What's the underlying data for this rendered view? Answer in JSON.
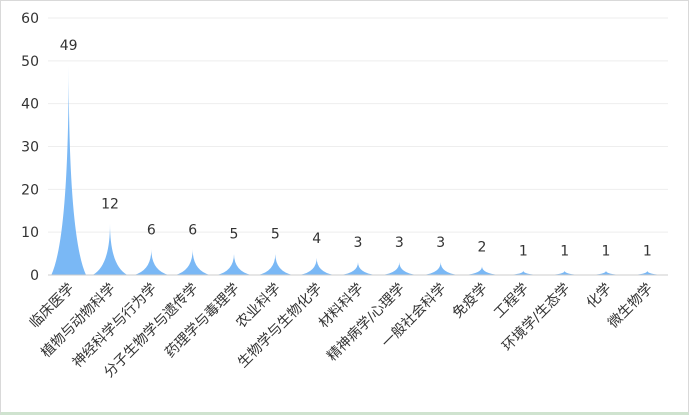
{
  "chart_data": {
    "type": "bar",
    "categories": [
      "临床医学",
      "植物与动物科学",
      "神经科学与行为学",
      "分子生物学与遗传学",
      "药理学与毒理学",
      "农业科学",
      "生物学与生物化学",
      "材料科学",
      "精神病学/心理学",
      "一般社会科学",
      "免疫学",
      "工程学",
      "环境学/生态学",
      "化学",
      "微生物学"
    ],
    "values": [
      49,
      12,
      6,
      6,
      5,
      5,
      4,
      3,
      3,
      3,
      2,
      1,
      1,
      1,
      1
    ],
    "ylim": [
      0,
      60
    ],
    "yticks": [
      0,
      10,
      20,
      30,
      40,
      50,
      60
    ],
    "grid": true,
    "colors": {
      "bar": "#7ab8f5",
      "grid": "#eeeeee",
      "axis": "#cccccc",
      "text": "#333333"
    }
  }
}
